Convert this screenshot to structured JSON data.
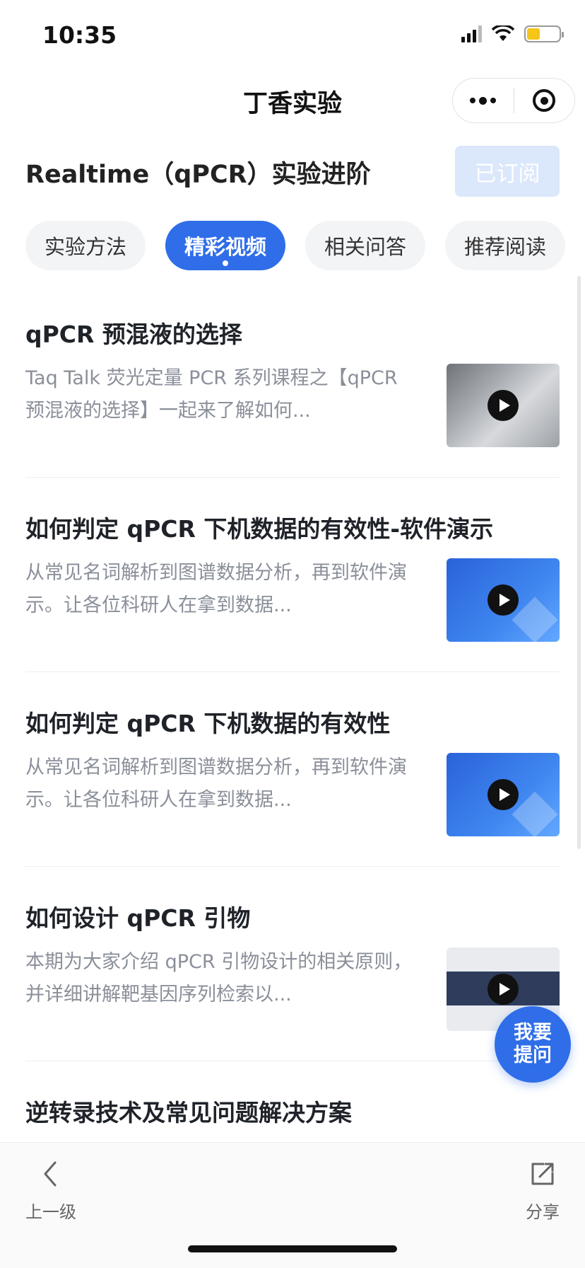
{
  "status_bar": {
    "time": "10:35"
  },
  "nav": {
    "title": "丁香实验"
  },
  "header": {
    "title": "Realtime（qPCR）实验进阶",
    "subscribe_label": "已订阅"
  },
  "tabs": [
    {
      "label": "实验方法",
      "active": false
    },
    {
      "label": "精彩视频",
      "active": true
    },
    {
      "label": "相关问答",
      "active": false
    },
    {
      "label": "推荐阅读",
      "active": false
    }
  ],
  "videos": [
    {
      "title": "qPCR 预混液的选择",
      "desc": "Taq Talk 荧光定量 PCR 系列课程之【qPCR 预混液的选择】一起来了解如何...",
      "thumb": "laptop-photo"
    },
    {
      "title": "如何判定 qPCR 下机数据的有效性-软件演示",
      "desc": "从常见名词解析到图谱数据分析，再到软件演示。让各位科研人在拿到数据...",
      "thumb": "blue-slide"
    },
    {
      "title": "如何判定 qPCR 下机数据的有效性",
      "desc": "从常见名词解析到图谱数据分析，再到软件演示。让各位科研人在拿到数据...",
      "thumb": "blue-slide"
    },
    {
      "title": "如何设计 qPCR 引物",
      "desc": "本期为大家介绍 qPCR 引物设计的相关原则，并详细讲解靶基因序列检索以...",
      "thumb": "vazyme-slide"
    },
    {
      "title": "逆转录技术及常见问题解决方案",
      "desc": "",
      "thumb": ""
    }
  ],
  "ask_button": {
    "label": "我要提问"
  },
  "bottom_bar": {
    "back_label": "上一级",
    "share_label": "分享"
  },
  "colors": {
    "accent": "#2f6ee8",
    "subscribed_bg": "#dbe7fb",
    "desc_text": "#8a8f99"
  }
}
